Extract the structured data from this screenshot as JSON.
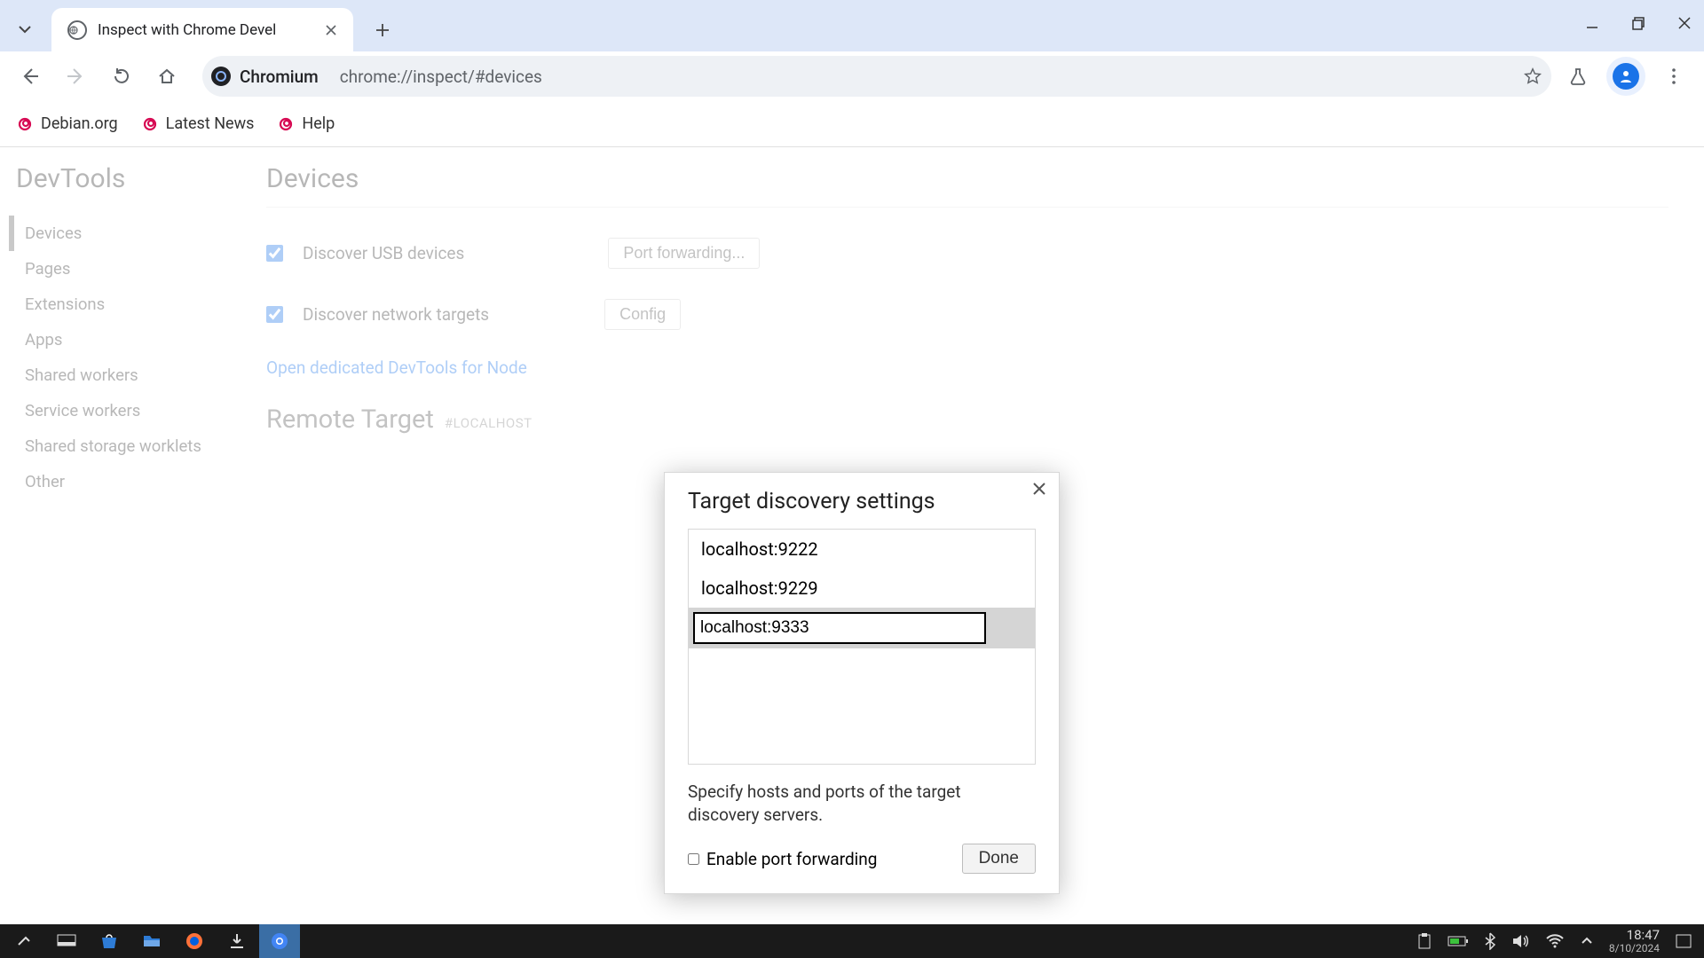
{
  "browser": {
    "tab_title": "Inspect with Chrome Devel",
    "secure_label": "Chromium",
    "url": "chrome://inspect/#devices"
  },
  "bookmarks": [
    {
      "label": "Debian.org"
    },
    {
      "label": "Latest News"
    },
    {
      "label": "Help"
    }
  ],
  "sidebar": {
    "heading": "DevTools",
    "items": [
      "Devices",
      "Pages",
      "Extensions",
      "Apps",
      "Shared workers",
      "Service workers",
      "Shared storage worklets",
      "Other"
    ],
    "active_index": 0
  },
  "main": {
    "heading": "Devices",
    "discover_usb_label": "Discover USB devices",
    "discover_usb_checked": true,
    "port_forwarding_btn": "Port forwarding...",
    "discover_net_label": "Discover network targets",
    "discover_net_checked": true,
    "configure_btn": "Config",
    "open_node_link": "Open dedicated DevTools for Node",
    "remote_heading": "Remote Target",
    "remote_subhead": "#LOCALHOST"
  },
  "modal": {
    "title": "Target discovery settings",
    "targets": [
      "localhost:9222",
      "localhost:9229"
    ],
    "editing_value": "localhost:9333",
    "help_text": "Specify hosts and ports of the target discovery servers.",
    "enable_pf_label": "Enable port forwarding",
    "enable_pf_checked": false,
    "done_label": "Done"
  },
  "taskbar": {
    "time": "18:47",
    "date": "8/10/2024"
  }
}
